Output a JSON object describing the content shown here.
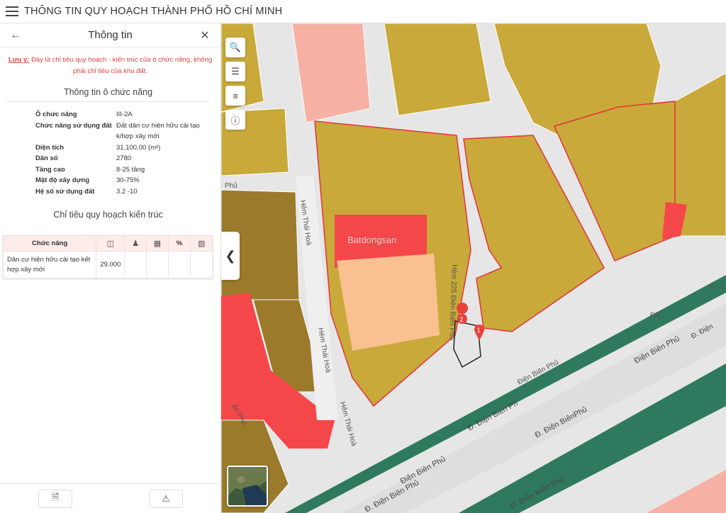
{
  "header": {
    "title": "THÔNG TIN QUY HOẠCH THÀNH PHỐ HỒ CHÍ MINH"
  },
  "panel": {
    "title": "Thông tin",
    "note_key": "Lưu ý:",
    "note_text": "Đây là chỉ tiêu quy hoạch - kiến trúc của ô chức năng, không phải chỉ tiêu của khu đất.",
    "section1": "Thông tin ô chức năng",
    "info": [
      {
        "k": "Ô chức năng",
        "v": "III-2A"
      },
      {
        "k": "Chức năng sử dụng đất",
        "v": "Đất dân cư hiện hữu cải tạo k/hợp xây mới"
      },
      {
        "k": "Diện tích",
        "v": "31.100,00 (m²)"
      },
      {
        "k": "Dân số",
        "v": "2780"
      },
      {
        "k": "Tầng cao",
        "v": "8-25 tầng"
      },
      {
        "k": "Mật độ xây dựng",
        "v": "30-75%"
      },
      {
        "k": "Hệ số sử dụng đất",
        "v": "3.2 -10"
      }
    ],
    "section2": "Chỉ tiêu quy hoạch kiến trúc",
    "table": {
      "h_function": "Chức năng",
      "h_percent": "%",
      "row_function": "Dân cư hiện hữu cải tạo kết hợp xây mới",
      "row_value": "29.000"
    }
  },
  "map": {
    "watermark": "Batdongsan",
    "labels": {
      "hem_thai_hoa_1": "Hẻm Thái Hoà",
      "hem_thai_hoa_2": "Hẻm Thái Hoà",
      "hem_thai_hoa_3": "Hẻm Thái Hoà",
      "hem_225": "Hẻm 225 Điện Biên Phủ",
      "dbp_1": "Điện Biên Phủ",
      "dbp_2": "Đ. Điện Biên Ph",
      "dbp_3": "Đ. Điện BiênPhủ",
      "dbp_4": "Điện Biên Phủ",
      "dbp_5": "Đ. Điện Biên Phủ",
      "dbp_6": "Đ. Điện Biên Phủ",
      "dbp_7": "Đ. Điện",
      "dbp_8": "Điệ",
      "dbp_9": "Đ. Đ",
      "dbp_10": "Điện Biên Phủ",
      "phu_left": "Phủ",
      "phu_mid": "ên Phủ"
    },
    "markers": [
      "1",
      "2"
    ],
    "colors": {
      "residential": "#c8a93a",
      "red": "#f4474a",
      "orange": "#f9c18f",
      "road": "#dcdcdc",
      "green": "#2f7a5f",
      "pink": "#f6b1a4"
    }
  }
}
